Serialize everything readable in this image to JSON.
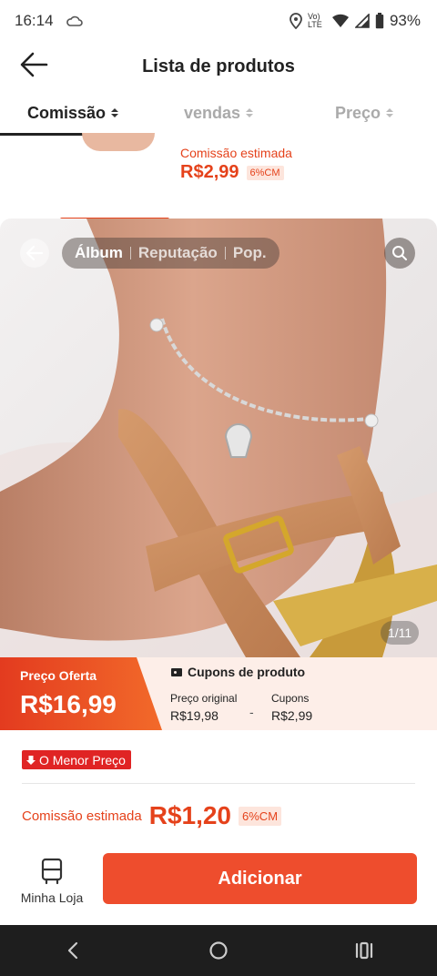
{
  "status_bar": {
    "time": "16:14",
    "network": "Vo) LTE",
    "battery": "93%"
  },
  "header": {
    "title": "Lista de produtos"
  },
  "sort_tabs": [
    {
      "label": "Comissão",
      "active": true
    },
    {
      "label": "vendas",
      "active": false
    },
    {
      "label": "Preço",
      "active": false
    }
  ],
  "background_item": {
    "commission_label": "Comissão estimada",
    "commission_value": "R$2,99",
    "commission_badge": "6%CM"
  },
  "gallery": {
    "tabs": [
      "Álbum",
      "Reputação",
      "Pop."
    ],
    "active_tab": "Álbum",
    "counter": "1/11"
  },
  "price": {
    "offer_label": "Preço Oferta",
    "offer_value": "R$16,99",
    "coupons_title": "Cupons de produto",
    "original_label": "Preço original",
    "original_value": "R$19,98",
    "minus": "-",
    "coupon_label": "Cupons",
    "coupon_value": "R$2,99"
  },
  "lowest_badge": "O Menor Preço",
  "commission": {
    "label": "Comissão estimada",
    "value": "R$1,20",
    "badge": "6%CM"
  },
  "actions": {
    "store_label": "Minha Loja",
    "add_label": "Adicionar"
  },
  "colors": {
    "accent": "#ee4d2d",
    "commission_text": "#e5421b",
    "badge_red": "#e02424",
    "nav_bar": "#1e1e1e"
  }
}
